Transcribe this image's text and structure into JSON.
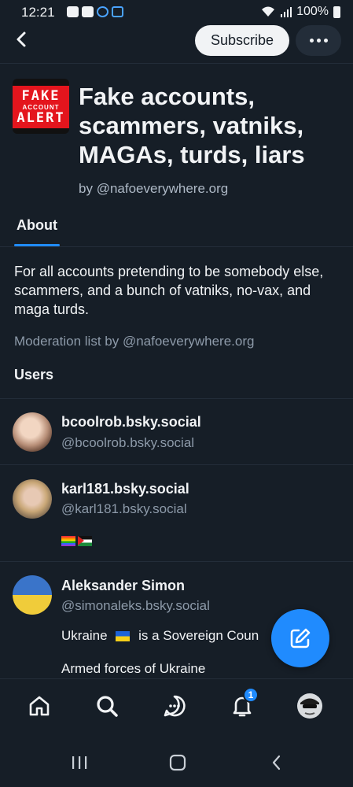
{
  "status_bar": {
    "time": "12:21",
    "battery": "100%"
  },
  "topbar": {
    "subscribe_label": "Subscribe"
  },
  "list": {
    "logo_text": [
      "FAKE",
      "ACCOUNT",
      "ALERT"
    ],
    "title": "Fake accounts, scammers, vatniks, MAGAs, turds, liars",
    "by_prefix": "by",
    "owner_handle": "@nafoeverywhere.org",
    "tab_about": "About",
    "description": "For all accounts pretending to be somebody else, scammers, and a bunch of vatniks, no-vax, and maga turds.",
    "moderation_text": "Moderation list by @nafoeverywhere.org",
    "users_heading": "Users"
  },
  "users": [
    {
      "name": "bcoolrob.bsky.social",
      "handle": "@bcoolrob.bsky.social",
      "bio": []
    },
    {
      "name": "karl181.bsky.social",
      "handle": "@karl181.bsky.social",
      "bio": []
    },
    {
      "name": "Aleksander Simon",
      "handle": "@simonaleks.bsky.social",
      "bio_line1_a": "Ukraine",
      "bio_line1_b": "is a Sovereign Coun",
      "bio_line2": "Armed forces of Ukraine"
    }
  ],
  "bottom_nav": {
    "notifications_badge": "1"
  },
  "colors": {
    "background": "#161e27",
    "accent": "#208bfe",
    "divider": "#232d39",
    "muted_text": "#8d9aa9",
    "logo_red": "#e4151d"
  },
  "icons": {
    "back": "back-arrow-icon",
    "more": "more-dots-icon",
    "compose": "compose-pencil-icon",
    "home": "home-icon",
    "search": "search-icon",
    "chat": "chat-icon",
    "notifications": "bell-icon",
    "profile": "avatar-icon"
  }
}
